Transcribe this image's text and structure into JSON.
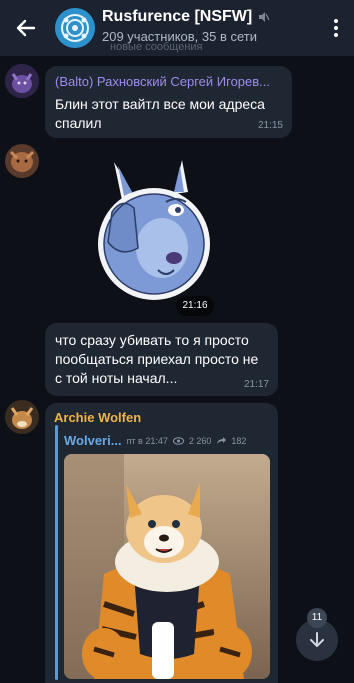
{
  "header": {
    "title": "Rusfurence [NSFW]",
    "subtitle": "209 участников, 35 в сети"
  },
  "faded_top_text": "новые сообщения",
  "messages": [
    {
      "sender": "(Balto) Рахновский Сергей Игорев...",
      "text": "Блин этот вайтл все мои адреса спалил",
      "time": "21:15",
      "sender_color": "#9d8cf0"
    },
    {
      "sticker_time": "21:16"
    },
    {
      "text": "что сразу убивать то я просто пообщаться приехал просто не с той ноты начал...",
      "time": "21:17"
    },
    {
      "sender": "Archie Wolfen",
      "sender_color": "#f0b34a",
      "forwarded": {
        "channel": "Wolveri...",
        "meta": "пт в 21:47",
        "views": "2 260",
        "shares": "182"
      }
    }
  ],
  "scroll": {
    "unread_count": "11"
  },
  "colors": {
    "header_bg": "#1c2330",
    "bubble_bg": "#1f2733",
    "app_bg": "#0d1117"
  }
}
